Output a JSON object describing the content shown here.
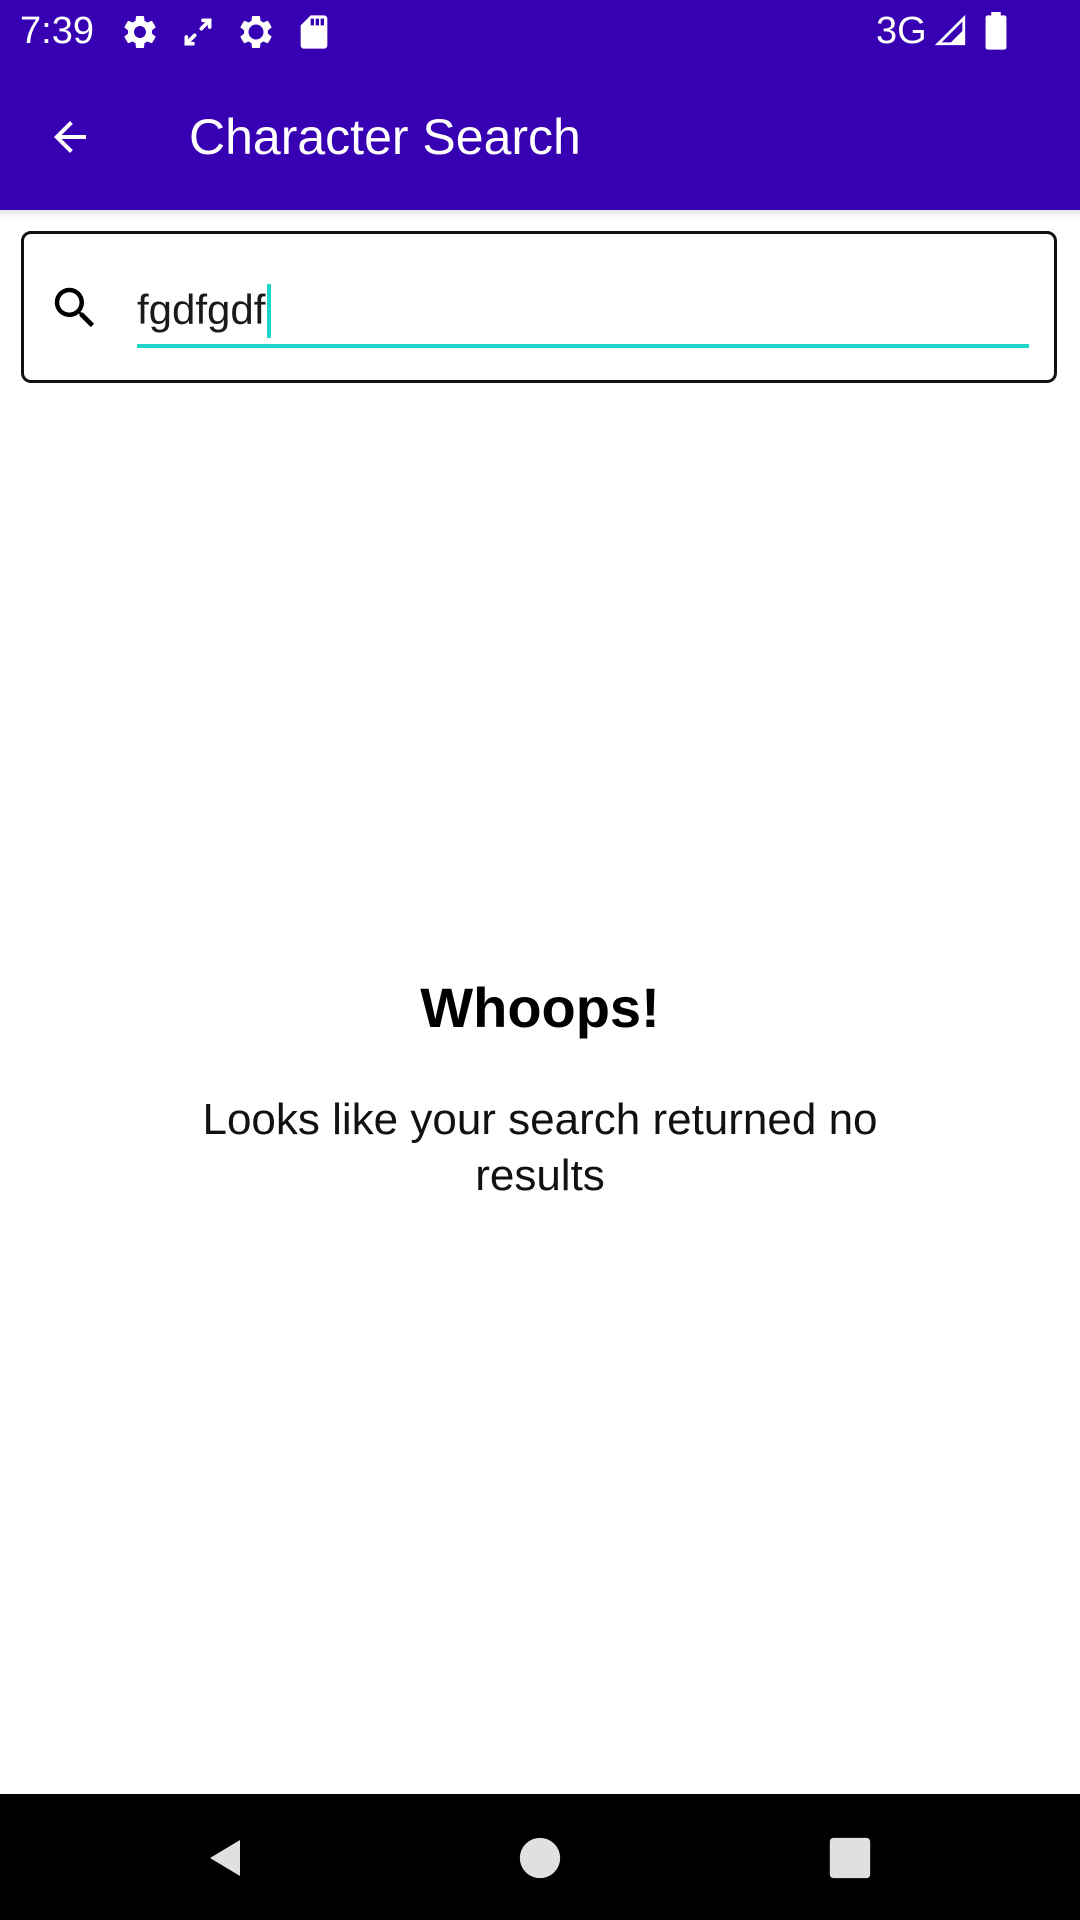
{
  "status_bar": {
    "time": "7:39",
    "icons": [
      "settings-icon",
      "sync-arrows-icon",
      "settings-outline-icon",
      "sd-card-icon"
    ],
    "network": "3G",
    "signal_icon": "cell-signal-icon",
    "battery_icon": "battery-icon"
  },
  "app_bar": {
    "title": "Character Search",
    "back_icon": "arrow-back-icon",
    "background": "#3700b3"
  },
  "search": {
    "value": "fgdfgdf",
    "icon": "search-icon",
    "underline_color": "#1fd6c8"
  },
  "empty_state": {
    "title": "Whoops!",
    "message": "Looks like your search returned no results"
  },
  "nav_bar": {
    "back_icon": "nav-back-triangle-icon",
    "home_icon": "nav-home-circle-icon",
    "recents_icon": "nav-recents-square-icon"
  }
}
